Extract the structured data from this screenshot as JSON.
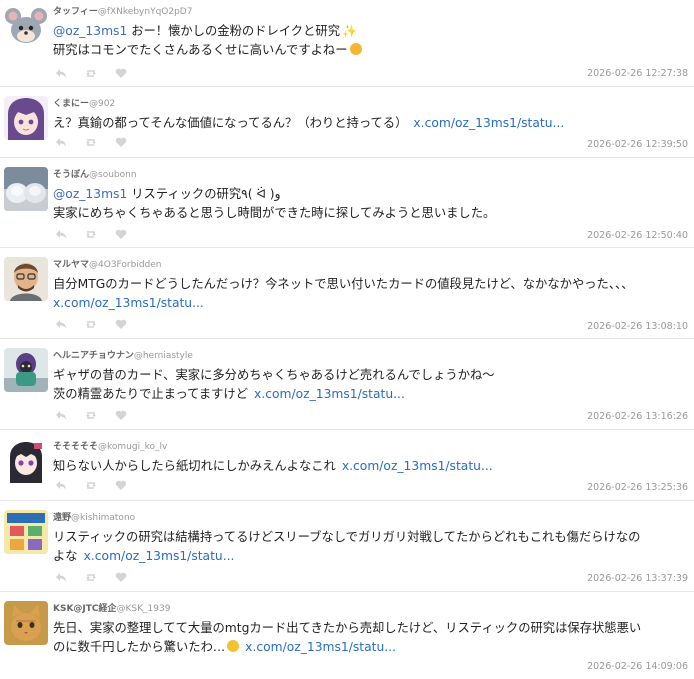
{
  "icons": {
    "reply": "reply-icon",
    "retweet": "retweet-icon",
    "like": "heart-icon"
  },
  "colors": {
    "link": "#2a6cc4",
    "timestamp": "#999999",
    "action_icon": "#d4d4d4",
    "name": "#666666"
  },
  "tweets": [
    {
      "name": "タッフィー",
      "handle": "@fXNkebynYqO2pD7",
      "lines": [
        {
          "mention": "@oz_13ms1",
          "text": " おー！懐かしの金粉のドレイクと研究",
          "emoji": "✨"
        },
        {
          "text": "研究はコモンでたくさんあるくせに高いんですよねー",
          "emoji": "🤣"
        }
      ],
      "time": "2026-02-26 12:27:38"
    },
    {
      "name": "くまにー",
      "handle": "@902",
      "lines": [
        {
          "text": "え？真鍮の都ってそんな価値になってるん？（わりと持ってる）",
          "link": "x.com/oz_13ms1/statu..."
        }
      ],
      "time": "2026-02-26 12:39:50"
    },
    {
      "name": "そうぼん",
      "handle": "@soubonn",
      "lines": [
        {
          "mention": "@oz_13ms1",
          "text": " リスティックの研究٩( ᐛ )و"
        },
        {
          "text": "実家にめちゃくちゃあると思うし時間ができた時に探してみようと思いました。"
        }
      ],
      "time": "2026-02-26 12:50:40"
    },
    {
      "name": "マルヤマ",
      "handle": "@4O3Forbidden",
      "lines": [
        {
          "text": "自分MTGのカードどうしたんだっけ？今ネットで思い付いたカードの値段見たけど、なかなかやった、、、"
        },
        {
          "link": "x.com/oz_13ms1/statu..."
        }
      ],
      "time": "2026-02-26 13:08:10"
    },
    {
      "name": "ヘルニアチョウナン",
      "handle": "@herniastyle",
      "lines": [
        {
          "text": "ギャザの昔のカード、実家に多分めちゃくちゃあるけど売れるんでしょうかね～"
        },
        {
          "text": "茨の精霊あたりで止まってますけど",
          "link": "x.com/oz_13ms1/statu..."
        }
      ],
      "time": "2026-02-26 13:16:26"
    },
    {
      "name": "そそそそそ",
      "handle": "@komugi_ko_lv",
      "lines": [
        {
          "text": "知らない人からしたら紙切れにしかみえんよなこれ",
          "link": "x.com/oz_13ms1/statu..."
        }
      ],
      "time": "2026-02-26 13:25:36"
    },
    {
      "name": "遠野",
      "handle": "@kishimatono",
      "lines": [
        {
          "text": "リスティックの研究は結構持ってるけどスリーブなしでガリガリ対戦してたからどれもこれも傷だらけなの"
        },
        {
          "text": "よな",
          "link": "x.com/oz_13ms1/statu..."
        }
      ],
      "time": "2026-02-26 13:37:39"
    },
    {
      "name": "KSK@JTC経企",
      "handle": "@KSK_1939",
      "lines": [
        {
          "text": "先日、実家の整理してて大量のmtgカード出てきたから売却したけど、リスティックの研究は保存状態悪い"
        },
        {
          "text": "のに数千円したから驚いたわ…",
          "emoji": "🤔",
          "link": "x.com/oz_13ms1/statu..."
        }
      ],
      "time": "2026-02-26 14:09:06"
    }
  ]
}
